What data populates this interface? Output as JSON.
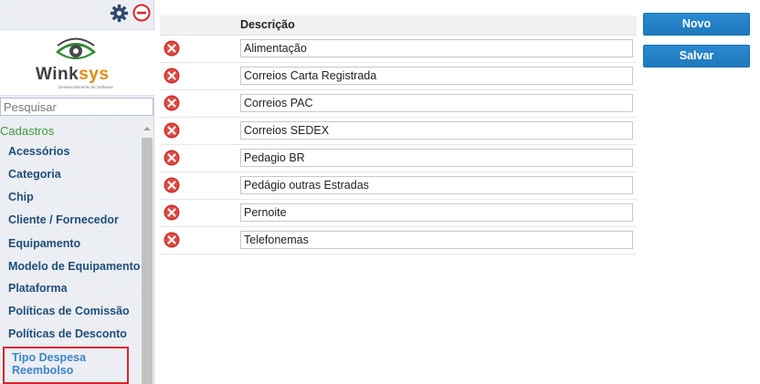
{
  "sidebar": {
    "logo": {
      "brand_part1": "Wink",
      "brand_part2": "sys",
      "tagline": "Desenvolvimento de Software"
    },
    "search": {
      "placeholder": "Pesquisar",
      "value": ""
    },
    "group_label": "Cadastros",
    "items": [
      {
        "label": "Acessórios"
      },
      {
        "label": "Categoria"
      },
      {
        "label": "Chip"
      },
      {
        "label": "Cliente / Fornecedor"
      },
      {
        "label": "Equipamento"
      },
      {
        "label": "Modelo de Equipamento"
      },
      {
        "label": "Plataforma"
      },
      {
        "label": "Políticas de Comissão"
      },
      {
        "label": "Políticas de Desconto"
      },
      {
        "label": "Tipo Despesa Reembolso",
        "active": true
      }
    ]
  },
  "toolbar_icons": {
    "settings": "gear-icon",
    "logout": "minus-circle-icon"
  },
  "table": {
    "header": "Descrição",
    "rows": [
      {
        "value": "Alimentação"
      },
      {
        "value": "Correios Carta Registrada"
      },
      {
        "value": "Correios PAC"
      },
      {
        "value": "Correios SEDEX"
      },
      {
        "value": "Pedagio BR"
      },
      {
        "value": "Pedágio outras Estradas"
      },
      {
        "value": "Pernoite"
      },
      {
        "value": "Telefonemas"
      }
    ]
  },
  "actions": {
    "new_label": "Novo",
    "save_label": "Salvar"
  },
  "colors": {
    "button": "#1f78bd",
    "nav_text": "#1f4e79",
    "active_border": "#d9232e",
    "group_label": "#3f9a3f",
    "delete_icon": "#c9302c"
  }
}
